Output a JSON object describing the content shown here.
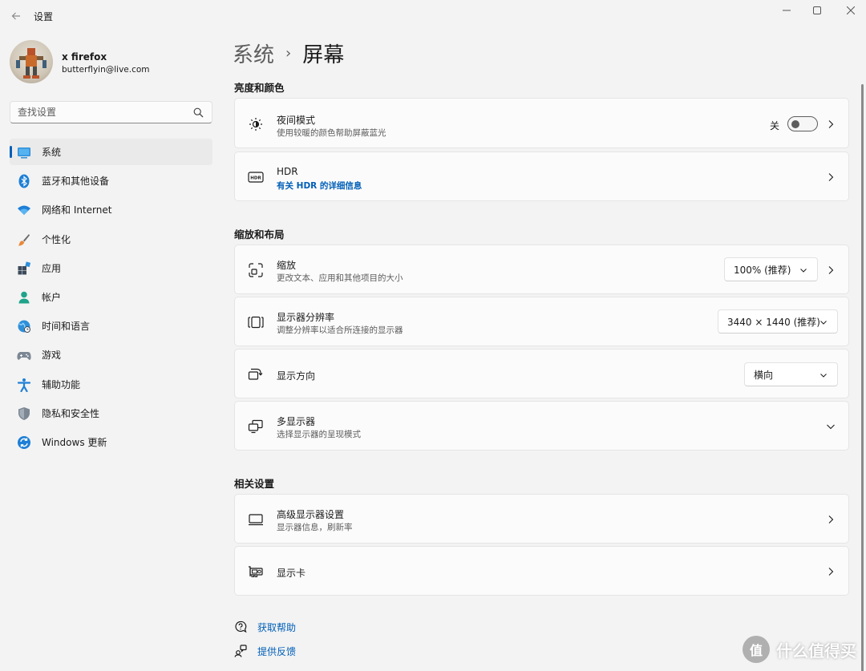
{
  "window": {
    "title": "设置",
    "controls": [
      "minimize",
      "maximize",
      "close"
    ]
  },
  "profile": {
    "name": "x firefox",
    "email": "butterflyin@live.com"
  },
  "search": {
    "placeholder": "查找设置"
  },
  "sidebar": {
    "items": [
      {
        "label": "系统",
        "icon": "monitor-icon",
        "active": true
      },
      {
        "label": "蓝牙和其他设备",
        "icon": "bluetooth-icon"
      },
      {
        "label": "网络和 Internet",
        "icon": "wifi-icon"
      },
      {
        "label": "个性化",
        "icon": "brush-icon"
      },
      {
        "label": "应用",
        "icon": "apps-icon"
      },
      {
        "label": "帐户",
        "icon": "account-icon"
      },
      {
        "label": "时间和语言",
        "icon": "globe-clock-icon"
      },
      {
        "label": "游戏",
        "icon": "gamepad-icon"
      },
      {
        "label": "辅助功能",
        "icon": "accessibility-icon"
      },
      {
        "label": "隐私和安全性",
        "icon": "shield-icon"
      },
      {
        "label": "Windows 更新",
        "icon": "update-icon"
      }
    ]
  },
  "breadcrumb": {
    "parent": "系统",
    "separator": "›",
    "current": "屏幕"
  },
  "sections": {
    "brightness": "亮度和颜色",
    "scale_layout": "缩放和布局",
    "related": "相关设置"
  },
  "cards": {
    "night_light": {
      "title": "夜间模式",
      "subtitle": "使用较暖的颜色帮助屏蔽蓝光",
      "toggle_label": "关",
      "toggle_on": false
    },
    "hdr": {
      "title": "HDR",
      "link": "有关 HDR 的详细信息"
    },
    "scale": {
      "title": "缩放",
      "subtitle": "更改文本、应用和其他项目的大小",
      "value": "100% (推荐)"
    },
    "resolution": {
      "title": "显示器分辨率",
      "subtitle": "调整分辨率以适合所连接的显示器",
      "value": "3440 × 1440 (推荐)"
    },
    "orientation": {
      "title": "显示方向",
      "value": "横向"
    },
    "multi_display": {
      "title": "多显示器",
      "subtitle": "选择显示器的呈现模式"
    },
    "advanced_display": {
      "title": "高级显示器设置",
      "subtitle": "显示器信息，刷新率"
    },
    "graphics": {
      "title": "显示卡"
    }
  },
  "help": {
    "get_help": "获取帮助",
    "feedback": "提供反馈"
  },
  "watermark": {
    "text": "什么值得买",
    "icon_glyph": "值"
  },
  "colors": {
    "accent": "#005fb8",
    "background": "#f3f3f3",
    "card": "#fbfbfb"
  }
}
